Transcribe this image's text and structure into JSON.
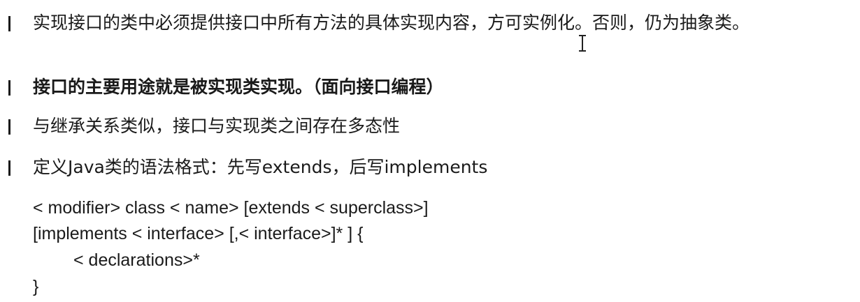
{
  "bullets": [
    {
      "text": "实现接口的类中必须提供接口中所有方法的具体实现内容，方可实例化。否则，仍为抽象类。",
      "bold": false
    },
    {
      "text": "接口的主要用途就是被实现类实现。（面向接口编程）",
      "bold": true
    },
    {
      "text": "与继承关系类似，接口与实现类之间存在多态性",
      "bold": false
    },
    {
      "text": "定义Java类的语法格式：先写extends，后写implements",
      "bold": false
    }
  ],
  "code": {
    "line1": "< modifier> class < name> [extends < superclass>]",
    "line2": "[implements < interface> [,< interface>]* ] {",
    "line3": "< declarations>*",
    "line4": "}"
  },
  "cursor_icon": "text-cursor-icon"
}
